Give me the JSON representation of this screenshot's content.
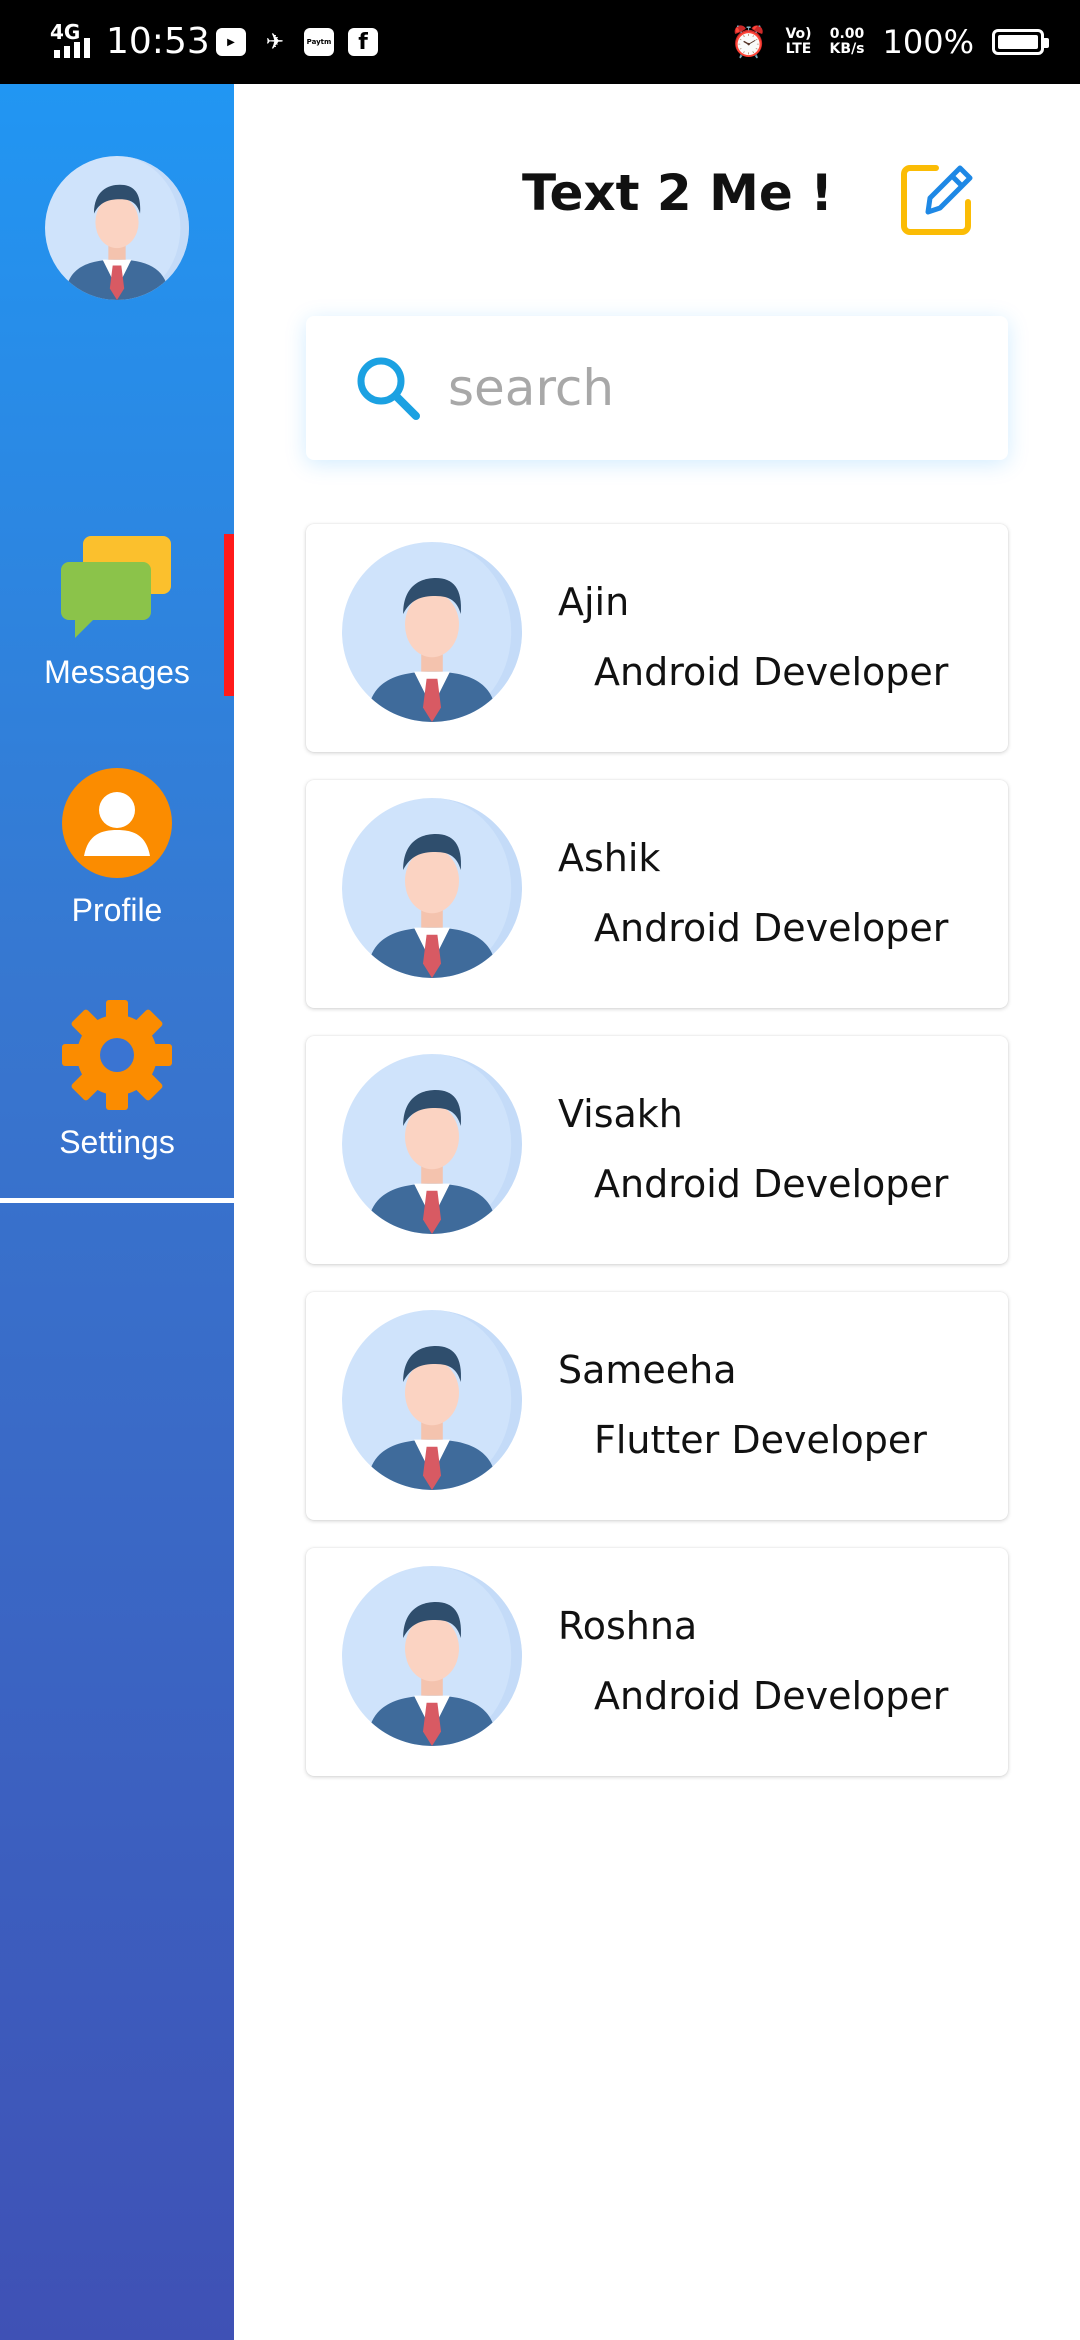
{
  "status_bar": {
    "network": "4G",
    "time": "10:53",
    "apps": [
      "youtube-icon",
      "bike-app-icon",
      "paytm-icon",
      "facebook-icon"
    ],
    "paytm_label": "Paytm",
    "volte_line1": "Vo)",
    "volte_line2": "LTE",
    "speed_line1": "0.00",
    "speed_line2": "KB/s",
    "battery": "100%"
  },
  "sidebar": {
    "items": [
      {
        "label": "Messages",
        "icon": "chat-bubbles-icon"
      },
      {
        "label": "Profile",
        "icon": "user-circle-icon"
      },
      {
        "label": "Settings",
        "icon": "gear-icon"
      }
    ],
    "active": "Messages",
    "colors": {
      "top": "#2196f3",
      "bottom": "#3f51b5",
      "active_indicator": "#ff1a1a"
    }
  },
  "header": {
    "title": "Text 2 Me !",
    "compose_icon": "edit-icon",
    "compose_color": "#fbbc05"
  },
  "search": {
    "placeholder": "search",
    "value": ""
  },
  "contacts": [
    {
      "name": "Ajin",
      "role": "Android Developer"
    },
    {
      "name": "Ashik",
      "role": "Android Developer"
    },
    {
      "name": "Visakh",
      "role": "Android Developer"
    },
    {
      "name": "Sameeha",
      "role": "Flutter Developer"
    },
    {
      "name": "Roshna",
      "role": "Android Developer"
    }
  ]
}
